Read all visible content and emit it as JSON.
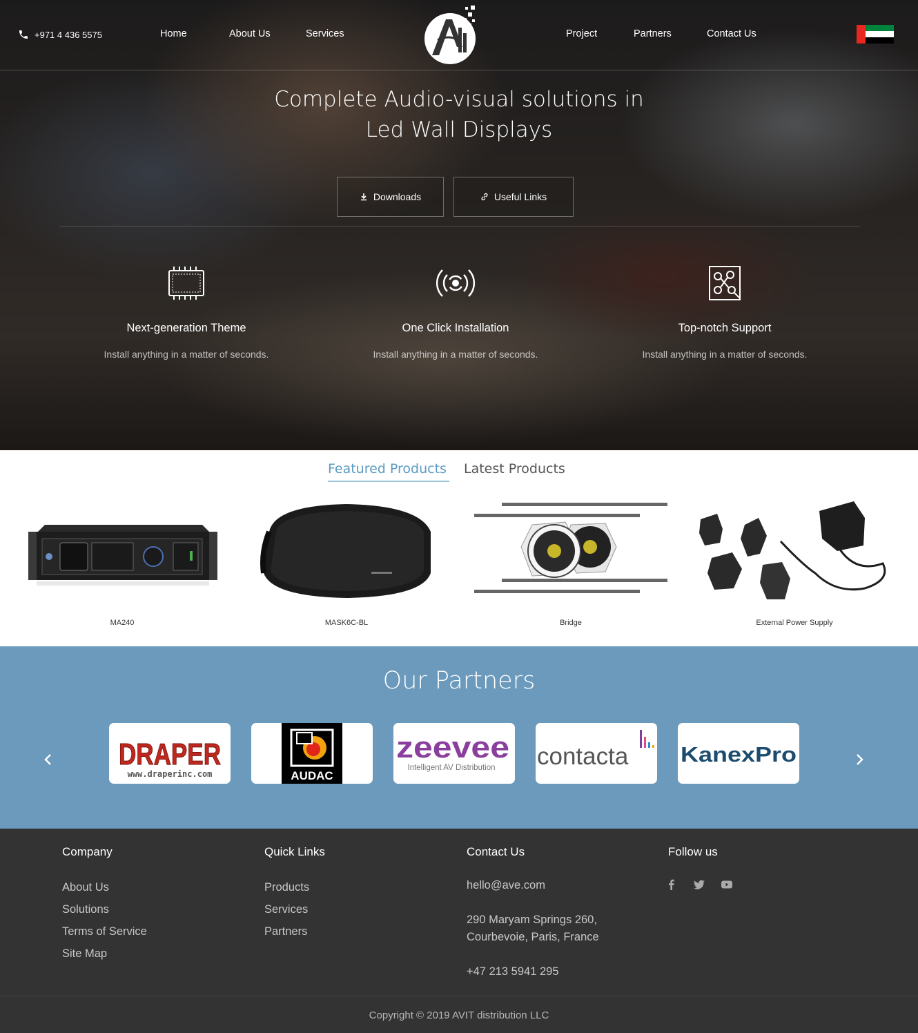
{
  "header": {
    "phone": "+971 4 436 5575",
    "nav_left": [
      "Home",
      "About Us",
      "Services"
    ],
    "nav_right": [
      "Project",
      "Partners",
      "Contact Us"
    ],
    "logo_text": "AVIT",
    "flag": "uae-flag"
  },
  "hero": {
    "title_line1": "Complete Audio-visual solutions in",
    "title_line2": "Led Wall Displays",
    "buttons": [
      {
        "label": "Downloads",
        "icon": "download-icon"
      },
      {
        "label": "Useful Links",
        "icon": "link-icon"
      }
    ],
    "features": [
      {
        "title": "Next-generation Theme",
        "text": "Install anything in a matter of seconds.",
        "icon": "display-panel-icon"
      },
      {
        "title": "One Click Installation",
        "text": "Install anything in a matter of seconds.",
        "icon": "broadcast-icon"
      },
      {
        "title": "Top-notch Support",
        "text": "Install anything in a matter of seconds.",
        "icon": "support-nodes-icon"
      }
    ]
  },
  "products": {
    "tabs": [
      "Featured Products",
      "Latest Products"
    ],
    "active_tab": "Featured Products",
    "items": [
      {
        "name": "MA240",
        "image": "amplifier-image"
      },
      {
        "name": "MASK6C-BL",
        "image": "speaker-image"
      },
      {
        "name": "Bridge",
        "image": "ceiling-speaker-bridge-image"
      },
      {
        "name": "External Power Supply",
        "image": "power-adapter-image"
      }
    ]
  },
  "partners": {
    "title": "Our Partners",
    "logos": [
      {
        "name": "DRAPER",
        "sub": "www.draperinc.com"
      },
      {
        "name": "AUDAC"
      },
      {
        "name": "zeevee",
        "sub": "Intelligent AV Distribution"
      },
      {
        "name": "contacta"
      },
      {
        "name": "KanexPro"
      }
    ]
  },
  "footer": {
    "company": {
      "title": "Company",
      "links": [
        "About Us",
        "Solutions",
        "Terms of Service",
        "Site Map"
      ]
    },
    "quick": {
      "title": "Quick Links",
      "links": [
        "Products",
        "Services",
        "Partners"
      ]
    },
    "contact": {
      "title": "Contact Us",
      "email": "hello@ave.com",
      "address_line1": "290 Maryam Springs 260,",
      "address_line2": "Courbevoie, Paris, France",
      "phone": "+47 213 5941 295"
    },
    "follow": {
      "title": "Follow us",
      "icons": [
        "facebook-icon",
        "twitter-icon",
        "youtube-icon"
      ]
    },
    "copyright": "Copyright © 2019 AVIT distribution LLC"
  },
  "colors": {
    "accent": "#5b9bc2",
    "partners_bg": "#6b9abc",
    "footer_bg": "#333333"
  }
}
